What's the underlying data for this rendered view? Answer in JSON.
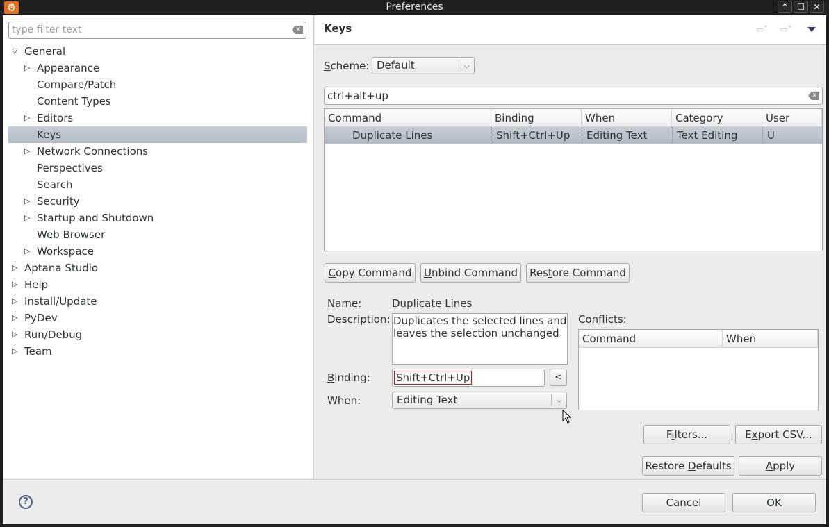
{
  "window": {
    "title": "Preferences",
    "controls": {
      "minimize": "↑",
      "maximize": "☐",
      "close": "✕"
    }
  },
  "left": {
    "filter_placeholder": "type filter text",
    "tree": [
      {
        "label": "General",
        "level": 0,
        "expander": "expanded"
      },
      {
        "label": "Appearance",
        "level": 1,
        "expander": "collapsed"
      },
      {
        "label": "Compare/Patch",
        "level": 1,
        "expander": "none"
      },
      {
        "label": "Content Types",
        "level": 1,
        "expander": "none"
      },
      {
        "label": "Editors",
        "level": 1,
        "expander": "collapsed"
      },
      {
        "label": "Keys",
        "level": 1,
        "expander": "none",
        "selected": true
      },
      {
        "label": "Network Connections",
        "level": 1,
        "expander": "collapsed"
      },
      {
        "label": "Perspectives",
        "level": 1,
        "expander": "none"
      },
      {
        "label": "Search",
        "level": 1,
        "expander": "none"
      },
      {
        "label": "Security",
        "level": 1,
        "expander": "collapsed"
      },
      {
        "label": "Startup and Shutdown",
        "level": 1,
        "expander": "collapsed"
      },
      {
        "label": "Web Browser",
        "level": 1,
        "expander": "none"
      },
      {
        "label": "Workspace",
        "level": 1,
        "expander": "collapsed"
      },
      {
        "label": "Aptana Studio",
        "level": 0,
        "expander": "collapsed"
      },
      {
        "label": "Help",
        "level": 0,
        "expander": "collapsed"
      },
      {
        "label": "Install/Update",
        "level": 0,
        "expander": "collapsed"
      },
      {
        "label": "PyDev",
        "level": 0,
        "expander": "collapsed"
      },
      {
        "label": "Run/Debug",
        "level": 0,
        "expander": "collapsed"
      },
      {
        "label": "Team",
        "level": 0,
        "expander": "collapsed"
      }
    ]
  },
  "right": {
    "title": "Keys",
    "nav": {
      "back": "⇦˅",
      "forward": "⇨˅"
    },
    "scheme": {
      "label_u": "S",
      "label_rest": "cheme:",
      "value": "Default"
    },
    "search_value": "ctrl+alt+up",
    "table": {
      "columns": [
        "Command",
        "Binding",
        "When",
        "Category",
        "User"
      ],
      "rows": [
        {
          "command": "Duplicate Lines",
          "binding": "Shift+Ctrl+Up",
          "when": "Editing Text",
          "category": "Text Editing",
          "user": "U"
        }
      ]
    },
    "buttons": {
      "copy": {
        "u": "C",
        "rest": "opy Command"
      },
      "unbind": {
        "u": "U",
        "rest": "nbind Command"
      },
      "restore": {
        "pre": "Res",
        "u": "t",
        "rest": "ore Command"
      }
    },
    "details": {
      "name_label": {
        "u": "N",
        "rest": "ame:"
      },
      "name_value": "Duplicate Lines",
      "description_label": {
        "pre": "D",
        "u": "e",
        "rest": "scription:"
      },
      "description_value": "Duplicates the selected lines and leaves the selection unchanged",
      "binding_label": {
        "u": "B",
        "rest": "inding:"
      },
      "binding_value": "Shift+Ctrl+Up",
      "when_label": {
        "u": "W",
        "rest": "hen:"
      },
      "when_value": "Editing Text"
    },
    "conflicts": {
      "label": {
        "pre": "Con",
        "u": "f",
        "rest": "licts:"
      },
      "columns": [
        "Command",
        "When"
      ]
    },
    "filters_button": {
      "pre": "F",
      "u": "i",
      "rest": "lters..."
    },
    "export_button": {
      "pre": "E",
      "u": "x",
      "rest": "port CSV..."
    },
    "restore_defaults": {
      "pre": "Restore ",
      "u": "D",
      "rest": "efaults"
    },
    "apply": {
      "u": "A",
      "rest": "pply"
    }
  },
  "bottom": {
    "cancel": "Cancel",
    "ok": "OK",
    "help_icon": "?"
  },
  "colors": {
    "selection": "#bac1ca",
    "binding_highlight": "#d01010",
    "app_icon": "#e07020"
  }
}
